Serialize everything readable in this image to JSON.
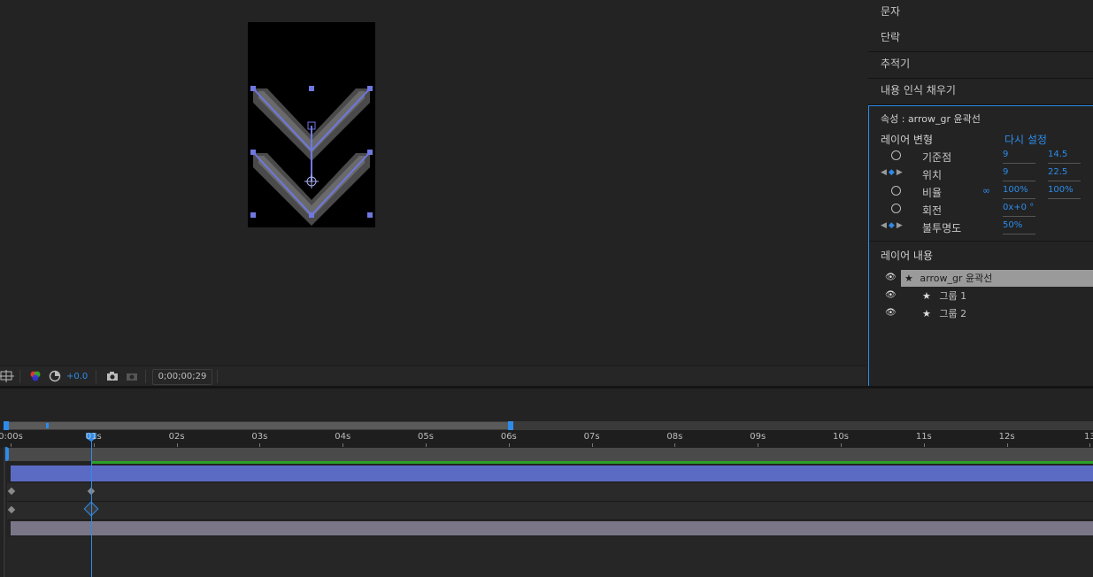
{
  "viewer": {
    "toolbar": {
      "exposure_value": "+0.0",
      "timecode": "0;00;00;29"
    }
  },
  "panels": {
    "character": "문자",
    "paragraph": "단락",
    "tracker": "추적기",
    "content_aware_fill": "내용 인식 채우기"
  },
  "properties": {
    "title": "속성 : arrow_gr 윤곽선",
    "layer_transform": {
      "heading": "레이어 변형",
      "reset": "다시 설정",
      "rows": [
        {
          "label": "기준점",
          "v1": "9",
          "v2": "14.5"
        },
        {
          "label": "위치",
          "v1": "9",
          "v2": "22.5"
        },
        {
          "label": "비율",
          "v1": "100%",
          "v2": "100%"
        },
        {
          "label": "회전",
          "v1": "0x+0 °",
          "v2": ""
        },
        {
          "label": "불투명도",
          "v1": "50%",
          "v2": ""
        }
      ]
    },
    "layer_contents": {
      "heading": "레이어 내용",
      "items": [
        "arrow_gr 윤곽선",
        "그룹 1",
        "그룹 2"
      ]
    }
  },
  "timeline": {
    "ruler": [
      "0:00s",
      "01s",
      "02s",
      "03s",
      "04s",
      "05s",
      "06s",
      "07s",
      "08s",
      "09s",
      "10s",
      "11s",
      "12s",
      "13"
    ],
    "colors": {
      "layer_bar": "#5b6bc4",
      "work_area": "#2aa12a",
      "playhead": "#2d8ceb",
      "track_gray": "#7a7688"
    }
  }
}
